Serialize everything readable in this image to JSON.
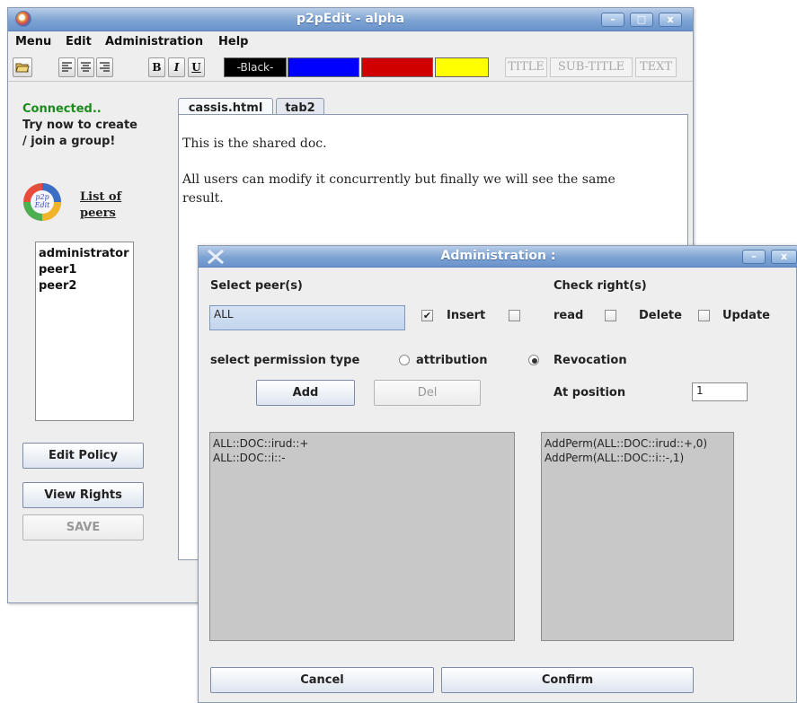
{
  "main_window": {
    "title": "p2pEdit - alpha",
    "window_buttons": [
      "–",
      "□",
      "x"
    ],
    "menu": [
      "Menu",
      "Edit",
      "Administration",
      "Help"
    ],
    "toolbar": {
      "bold": "B",
      "italic": "I",
      "underline": "U",
      "colors": [
        {
          "label": "-Black-",
          "hex": "#000000"
        },
        {
          "label": "",
          "hex": "#0000ff"
        },
        {
          "label": "",
          "hex": "#d00000"
        },
        {
          "label": "",
          "hex": "#ffff00"
        }
      ],
      "styles": [
        "TITLE",
        "SUB-TITLE",
        "TEXT"
      ]
    },
    "status": {
      "connected": "Connected..",
      "hint_line1": "Try now to create",
      "hint_line2": "/ join a group!"
    },
    "logo_text": "p2p Edit",
    "peers_link_line1": "List of",
    "peers_link_line2": "peers",
    "peers": [
      "administrator",
      "peer1",
      "peer2"
    ],
    "buttons": {
      "edit_policy": "Edit Policy",
      "view_rights": "View Rights",
      "save": "SAVE"
    },
    "tabs": [
      "cassis.html",
      "tab2"
    ],
    "document": {
      "para1": "This is the shared doc.",
      "para2_line1": "All users can modify it concurrently but finally we will see the same",
      "para2_line2": "result."
    }
  },
  "admin_dialog": {
    "title": "Administration :",
    "select_peers_label": "Select peer(s)",
    "peer_value": "ALL",
    "check_rights_label": "Check right(s)",
    "rights": [
      {
        "label": "Insert",
        "checked": true
      },
      {
        "label": "read",
        "checked": false
      },
      {
        "label": "Delete",
        "checked": false
      },
      {
        "label": "Update",
        "checked": false
      }
    ],
    "permission_type_label": "select permission type",
    "permission_options": [
      {
        "label": "attribution",
        "selected": false
      },
      {
        "label": "Revocation",
        "selected": true
      }
    ],
    "add_button": "Add",
    "del_button": "Del",
    "position_label": "At position",
    "position_value": "1",
    "policies": [
      "ALL::DOC::irud::+",
      "ALL::DOC::i::-"
    ],
    "operations": [
      "AddPerm(ALL::DOC::irud::+,0)",
      "AddPerm(ALL::DOC::i::-,1)"
    ],
    "cancel_button": "Cancel",
    "confirm_button": "Confirm"
  }
}
